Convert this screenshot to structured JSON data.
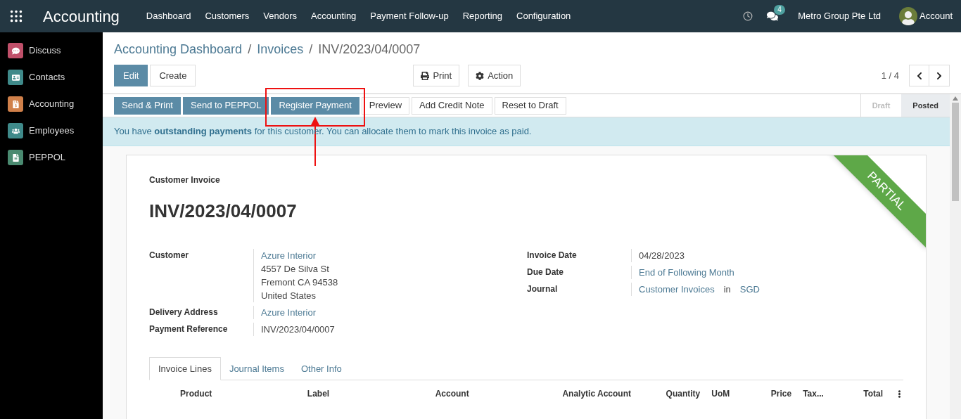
{
  "navbar": {
    "app_title": "Accounting",
    "menu": [
      "Dashboard",
      "Customers",
      "Vendors",
      "Accounting",
      "Payment Follow-up",
      "Reporting",
      "Configuration"
    ],
    "message_count": "4",
    "company": "Metro Group Pte Ltd",
    "user": "Account"
  },
  "sidebar": {
    "items": [
      {
        "label": "Discuss",
        "color": "#c0506a"
      },
      {
        "label": "Contacts",
        "color": "#3f8a8a"
      },
      {
        "label": "Accounting",
        "color": "#d0804a"
      },
      {
        "label": "Employees",
        "color": "#3f8a8a"
      },
      {
        "label": "PEPPOL",
        "color": "#4a8a70"
      }
    ]
  },
  "breadcrumb": [
    {
      "label": "Accounting Dashboard",
      "link": true
    },
    {
      "label": "Invoices",
      "link": true
    },
    {
      "label": "INV/2023/04/0007",
      "link": false
    }
  ],
  "breadcrumb_separator": "/",
  "control_buttons": [
    {
      "label": "Edit",
      "primary": true
    },
    {
      "label": "Create",
      "primary": false
    }
  ],
  "action_buttons": [
    "Print",
    "Action"
  ],
  "pager": "1 / 4",
  "header_buttons": [
    {
      "label": "Send & Print",
      "primary": true,
      "highlighted": false
    },
    {
      "label": "Send to PEPPOL",
      "primary": true,
      "highlighted": false
    },
    {
      "label": "Register Payment",
      "primary": true,
      "highlighted": true
    },
    {
      "label": "Preview",
      "primary": false,
      "highlighted": false
    },
    {
      "label": "Add Credit Note",
      "primary": false,
      "highlighted": false
    },
    {
      "label": "Reset to Draft",
      "primary": false,
      "highlighted": false
    }
  ],
  "statusbar": [
    {
      "label": "Draft",
      "selected": false
    },
    {
      "label": "Posted",
      "selected": true
    }
  ],
  "alert": "You have **outstanding payments** for this customer. You can allocate them to mark this invoice as paid.",
  "sheet": {
    "ribbon": "PARTIAL",
    "doc_type": "Customer Invoice",
    "name": "INV/2023/04/0007",
    "left_fields": [
      {
        "label": "Customer",
        "lines": [
          {
            "text": "Azure Interior",
            "link": true
          },
          {
            "text": "4557 De Silva St",
            "link": false
          },
          {
            "text": "Fremont CA 94538",
            "link": false
          },
          {
            "text": "United States",
            "link": false
          }
        ]
      },
      {
        "label": "Delivery Address",
        "lines": [
          {
            "text": "Azure Interior",
            "link": true
          }
        ]
      },
      {
        "label": "Payment Reference",
        "lines": [
          {
            "text": "INV/2023/04/0007",
            "link": false
          }
        ]
      }
    ],
    "right_fields": [
      {
        "label": "Invoice Date",
        "parts": [
          {
            "text": "04/28/2023",
            "link": false
          }
        ]
      },
      {
        "label": "Due Date",
        "parts": [
          {
            "text": "End of Following Month",
            "link": true
          }
        ]
      },
      {
        "label": "Journal",
        "parts": [
          {
            "text": "Customer Invoices",
            "link": true
          },
          {
            "text": "in",
            "link": false
          },
          {
            "text": "SGD",
            "link": true
          }
        ]
      }
    ],
    "tabs": [
      {
        "label": "Invoice Lines",
        "selected": true
      },
      {
        "label": "Journal Items",
        "selected": false
      },
      {
        "label": "Other Info",
        "selected": false
      }
    ],
    "columns": [
      "Product",
      "Label",
      "Account",
      "Analytic Account",
      "Quantity",
      "UoM",
      "Price",
      "Tax...",
      "Total"
    ]
  }
}
